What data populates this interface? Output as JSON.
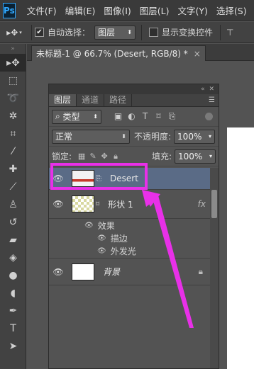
{
  "menubar": {
    "logo": "Ps",
    "items": [
      "文件(F)",
      "编辑(E)",
      "图像(I)",
      "图层(L)",
      "文字(Y)",
      "选择(S)"
    ]
  },
  "options": {
    "auto_select_label": "自动选择：",
    "auto_select_value": "图层",
    "show_transform_label": "显示变换控件"
  },
  "document_tab": {
    "title": "未标题-1 @ 66.7% (Desert, RGB/8) *",
    "close": "×"
  },
  "layers_panel": {
    "tabs": [
      "图层",
      "通道",
      "路径"
    ],
    "filter_kind": "类型",
    "blend_mode": "正常",
    "opacity_label": "不透明度:",
    "opacity_value": "100%",
    "lock_label": "锁定:",
    "fill_label": "填充:",
    "fill_value": "100%",
    "layers": [
      {
        "name": "Desert",
        "selected": true
      },
      {
        "name": "形状 1",
        "fx": "fx"
      },
      {
        "name": "效果"
      },
      {
        "name": "描边"
      },
      {
        "name": "外发光"
      },
      {
        "name": "背景",
        "locked": true
      }
    ]
  },
  "annotation": {
    "color": "#e830e8"
  }
}
